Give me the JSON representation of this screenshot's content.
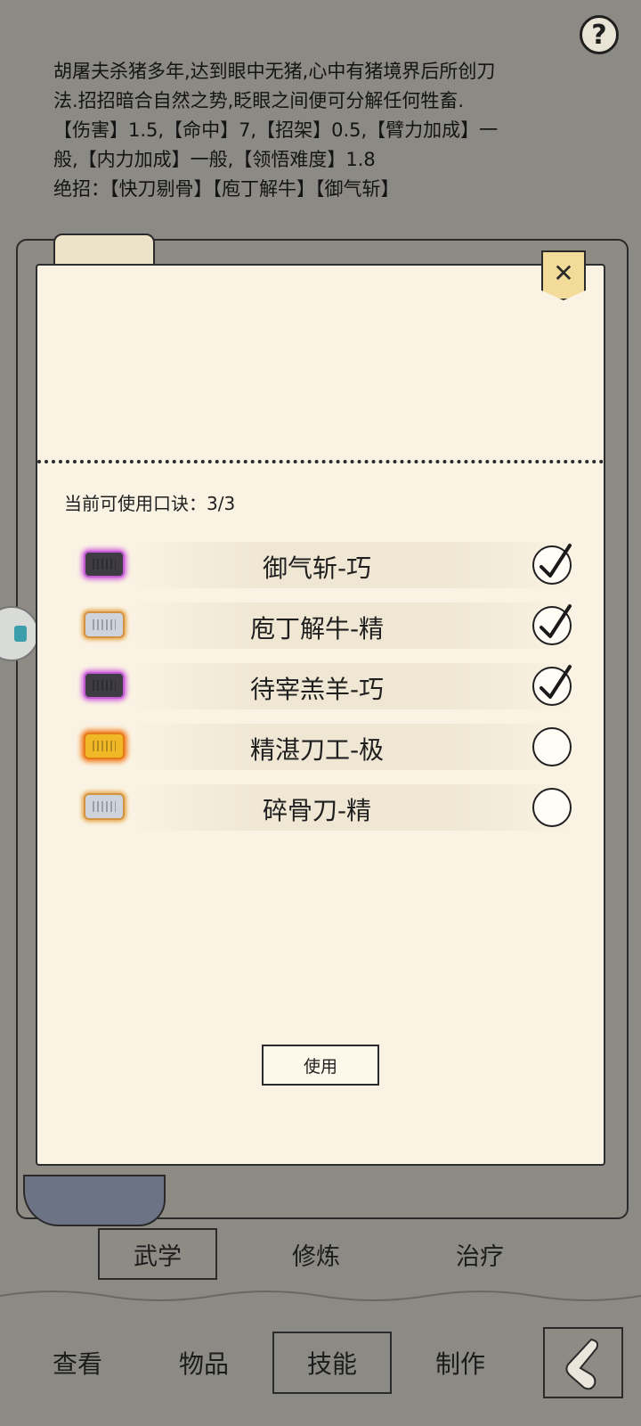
{
  "description": {
    "line1": "胡屠夫杀猪多年,达到眼中无猪,心中有猪境界后所创刀",
    "line2": "法.招招暗合自然之势,眨眼之间便可分解任何牲畜.",
    "line3": "【伤害】1.5,【命中】7,【招架】0.5,【臂力加成】一",
    "line4": "般,【内力加成】一般,【领悟难度】1.8",
    "line5": "绝招：【快刀剔骨】【庖丁解牛】【御气斩】"
  },
  "help": {
    "label": "?"
  },
  "panel": {
    "close_label": "✕",
    "count_label": "当前可使用口诀：3/3",
    "use_button": "使用"
  },
  "skills": [
    {
      "name": "御气斩-巧",
      "chip": "purple",
      "selected": true
    },
    {
      "name": "庖丁解牛-精",
      "chip": "silver",
      "selected": true
    },
    {
      "name": "待宰羔羊-巧",
      "chip": "purple",
      "selected": true
    },
    {
      "name": "精湛刀工-极",
      "chip": "gold",
      "selected": false
    },
    {
      "name": "碎骨刀-精",
      "chip": "silver",
      "selected": false
    }
  ],
  "sub_tabs": [
    {
      "label": "武学",
      "active": true
    },
    {
      "label": "修炼",
      "active": false
    },
    {
      "label": "治疗",
      "active": false
    }
  ],
  "nav": [
    {
      "label": "查看",
      "active": false
    },
    {
      "label": "物品",
      "active": false
    },
    {
      "label": "技能",
      "active": true
    },
    {
      "label": "制作",
      "active": false
    }
  ]
}
